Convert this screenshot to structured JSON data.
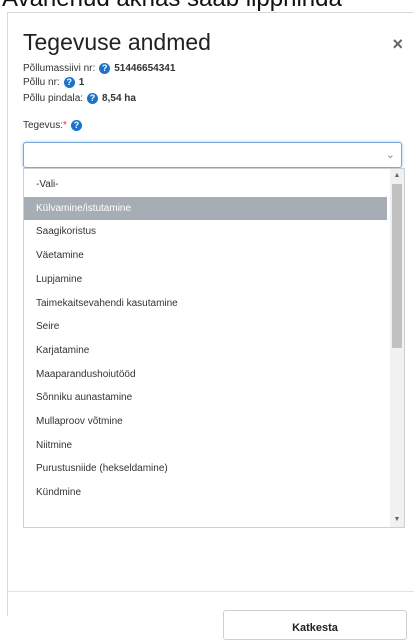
{
  "top_banner": {
    "text": "Avanenud aknas saab lipphinda"
  },
  "dialog": {
    "title": "Tegevuse andmed",
    "close_glyph": "×",
    "help_glyph": "?"
  },
  "info": {
    "field_number_label": "Põllumassiivi nr:",
    "field_number_value": "51446654341",
    "plot_number_label": "Põllu nr:",
    "plot_number_value": "1",
    "plot_area_label": "Põllu pindala:",
    "plot_area_value": "8,54 ha"
  },
  "activity": {
    "label": "Tegevus:",
    "required_mark": "*",
    "selected_value": "",
    "arrow_glyph": "⌄",
    "options": [
      "-Vali-",
      "Külvamine/istutamine",
      "Saagikoristus",
      "Väetamine",
      "Lupjamine",
      "Taimekaitsevahendi kasutamine",
      "Seire",
      "Karjatamine",
      "Maaparandushoiutööd",
      "Sõnniku aunastamine",
      "Mullaproov võtmine",
      "Niitmine",
      "Purustusniide (hekseldamine)",
      "Kündmine"
    ],
    "highlighted_index": 1,
    "scroll_up_glyph": "▲",
    "scroll_down_glyph": "▼"
  },
  "footer": {
    "cancel_label": "Katkesta"
  }
}
